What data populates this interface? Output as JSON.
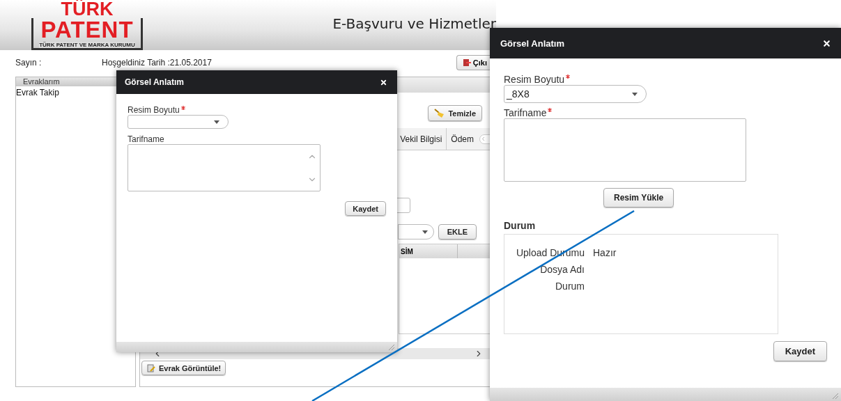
{
  "header": {
    "logo": {
      "top": "TÜRK",
      "main": "PATENT",
      "subtitle": "TÜRK PATENT VE MARKA KURUMU"
    },
    "title": "E-Başvuru ve Hizmetler"
  },
  "info_bar": {
    "greeting": "Sayın :",
    "date": "Hoşgeldiniz Tarih :21.05.2017",
    "exit_button": "Çıkı"
  },
  "sidebar": {
    "header": "Evraklarım",
    "items": [
      {
        "label": "Evrak Takip"
      }
    ]
  },
  "main": {
    "clear_button": "Temizle",
    "tabs": [
      {
        "label": "Vekil Bilgisi"
      },
      {
        "label": "Ödem"
      }
    ],
    "add_button": "EKLE",
    "grid": {
      "columns": [
        "SİM"
      ]
    },
    "view_button": "Evrak Görüntüle!"
  },
  "dialogs": [
    {
      "title": "Görsel Anlatım",
      "fields": [
        {
          "kind": "select",
          "label": "Resim Boyutu",
          "required": true
        },
        {
          "kind": "textarea",
          "label": "Tarifname",
          "required": false,
          "scroll_arrows": true
        }
      ],
      "save_button": "Kaydet"
    },
    {
      "title": "Görsel Anlatım",
      "fields": [
        {
          "kind": "select",
          "label": "Resim Boyutu",
          "required": true,
          "value": "_8X8"
        },
        {
          "kind": "textarea",
          "label": "Tarifname",
          "required": true,
          "scroll_arrows": false
        }
      ],
      "upload_button": "Resim Yükle",
      "status": {
        "title": "Durum",
        "rows": [
          {
            "label": "Upload Durumu",
            "value": "Hazır"
          },
          {
            "label": "Dosya Adı"
          },
          {
            "label": "Durum"
          }
        ]
      },
      "save_button": "Kaydet"
    }
  ]
}
